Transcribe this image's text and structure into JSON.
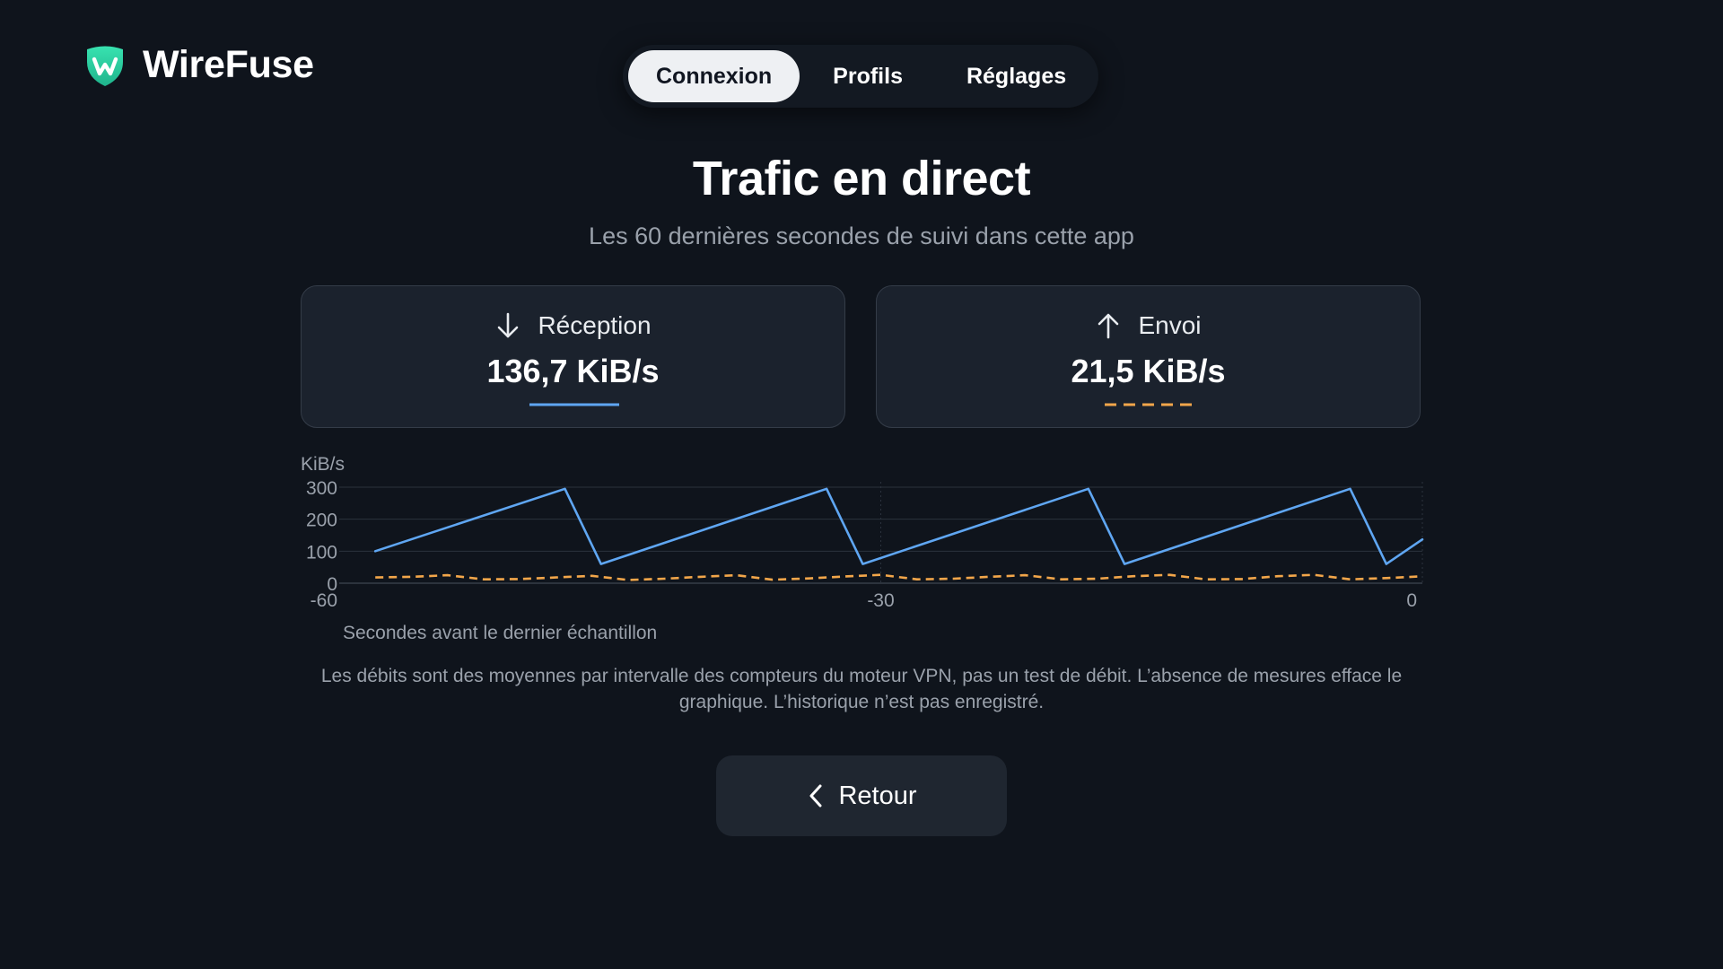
{
  "app": {
    "name": "WireFuse",
    "logo_icon": "shield-w-logo-icon",
    "accent_color": "#2fd5a4"
  },
  "nav": {
    "tabs": [
      {
        "label": "Connexion",
        "active": true
      },
      {
        "label": "Profils",
        "active": false
      },
      {
        "label": "Réglages",
        "active": false
      }
    ]
  },
  "page": {
    "title": "Trafic en direct",
    "subtitle": "Les 60 dernières secondes de suivi dans cette app"
  },
  "cards": {
    "receive": {
      "label": "Réception",
      "value": "136,7 KiB/s",
      "icon": "arrow-down-icon",
      "color": "#5fa6f2",
      "line_style": "solid"
    },
    "send": {
      "label": "Envoi",
      "value": "21,5 KiB/s",
      "icon": "arrow-up-icon",
      "color": "#f2a64a",
      "line_style": "dashed"
    }
  },
  "chart_data": {
    "type": "line",
    "ylabel": "KiB/s",
    "xlabel": "Secondes avant le dernier échantillon",
    "xlim": [
      -60,
      0
    ],
    "ylim": [
      0,
      300
    ],
    "yticks": [
      0,
      100,
      200,
      300
    ],
    "xticks": [
      -60,
      -30,
      0
    ],
    "xtick_labels": [
      "-60",
      "-30",
      "0"
    ],
    "ytick_labels": [
      "0",
      "100",
      "200",
      "300"
    ],
    "grid": true,
    "series": [
      {
        "key": "receive",
        "color": "#5fa6f2",
        "style": "solid",
        "x": [
          -58,
          -47.5,
          -45.5,
          -33,
          -31,
          -18.5,
          -16.5,
          -4,
          -2,
          0
        ],
        "y": [
          100,
          295,
          60,
          295,
          60,
          295,
          60,
          295,
          60,
          136.7
        ]
      },
      {
        "key": "send",
        "color": "#f2a64a",
        "style": "dashed",
        "x": [
          -58,
          -56,
          -54,
          -52,
          -50,
          -48,
          -46,
          -44,
          -42,
          -40,
          -38,
          -36,
          -34,
          -32,
          -30,
          -28,
          -26,
          -24,
          -22,
          -20,
          -18,
          -16,
          -14,
          -12,
          -10,
          -8,
          -6,
          -4,
          -2,
          0
        ],
        "y": [
          18,
          20,
          25,
          12,
          13,
          18,
          23,
          10,
          14,
          20,
          25,
          11,
          15,
          21,
          26,
          12,
          14,
          20,
          25,
          12,
          14,
          22,
          26,
          12,
          13,
          22,
          26,
          12,
          16,
          21.5
        ]
      }
    ]
  },
  "note": "Les débits sont des moyennes par intervalle des compteurs du moteur VPN, pas un test de débit. L’absence de mesures efface le graphique. L’historique n’est pas enregistré.",
  "back_button": {
    "label": "Retour",
    "icon": "chevron-left-icon"
  }
}
